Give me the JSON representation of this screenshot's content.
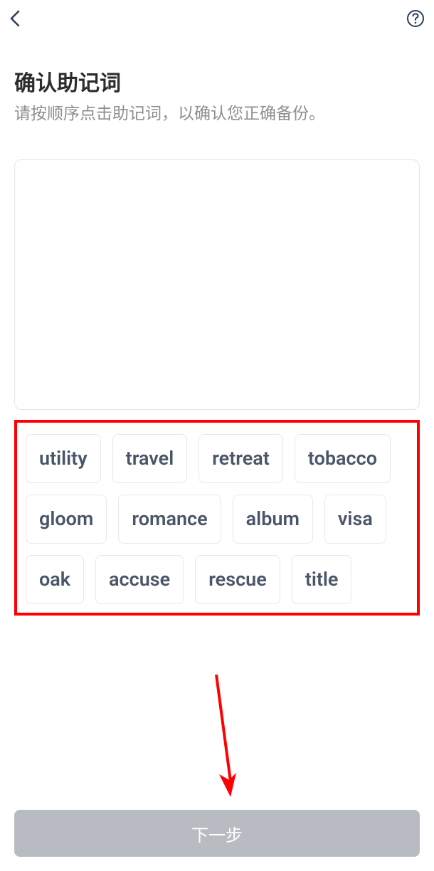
{
  "header": {
    "back_label": "back",
    "help_label": "help"
  },
  "page": {
    "title": "确认助记词",
    "subtitle": "请按顺序点击助记词，以确认您正确备份。"
  },
  "words": [
    "utility",
    "travel",
    "retreat",
    "tobacco",
    "gloom",
    "romance",
    "album",
    "visa",
    "oak",
    "accuse",
    "rescue",
    "title"
  ],
  "footer": {
    "next_button": "下一步"
  },
  "colors": {
    "highlight_border": "#ff0000",
    "arrow": "#ff0000",
    "button_disabled": "#b8bcc2"
  }
}
